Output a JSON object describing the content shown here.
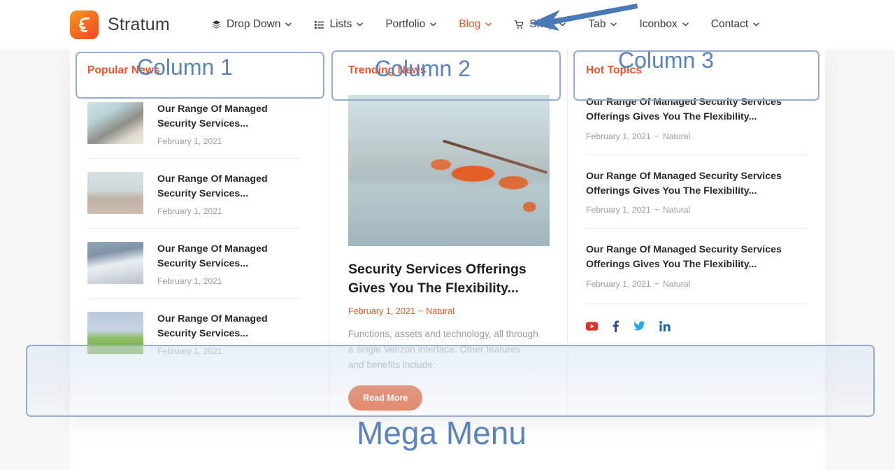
{
  "header": {
    "brand": {
      "name": "Stratum",
      "logo_icon": "stratum-logo-icon"
    },
    "nav": [
      {
        "label": "Drop Down",
        "icon": "layers-icon",
        "caret": "⌄",
        "active": false
      },
      {
        "label": "Lists",
        "icon": "list-icon",
        "caret": "⌄",
        "active": false
      },
      {
        "label": "Portfolio",
        "icon": null,
        "caret": "⌄",
        "active": false
      },
      {
        "label": "Blog",
        "icon": null,
        "caret": "⌄",
        "active": true
      },
      {
        "label": "Shop",
        "icon": "cart-icon",
        "caret": "⌄",
        "active": false
      },
      {
        "label": "Tab",
        "icon": null,
        "caret": "⌄",
        "active": false
      },
      {
        "label": "Iconbox",
        "icon": null,
        "caret": "⌄",
        "active": false
      },
      {
        "label": "Contact",
        "icon": null,
        "caret": "⌄",
        "active": false
      }
    ]
  },
  "mega_menu": {
    "column1": {
      "title": "Popular News",
      "posts": [
        {
          "title": "Our Range Of Managed Security Services...",
          "date": "February 1, 2021",
          "thumb": "rocks-beach-thumb"
        },
        {
          "title": "Our Range Of Managed Security Services...",
          "date": "February 1, 2021",
          "thumb": "lifeguard-tower-thumb"
        },
        {
          "title": "Our Range Of Managed Security Services...",
          "date": "February 1, 2021",
          "thumb": "mountain-clouds-thumb"
        },
        {
          "title": "Our Range Of Managed Security Services...",
          "date": "February 1, 2021",
          "thumb": "palm-leaf-thumb"
        }
      ]
    },
    "column2": {
      "title": "Trending News",
      "feature": {
        "image": "autumn-branch-lake-image",
        "title": "Security Services Offerings Gives You The Flexibility...",
        "date": "February 1, 2021",
        "separator": "~",
        "category": "Natural",
        "excerpt": "Functions, assets and technology, all through a single Verizon interface. Other features and benefits include:",
        "read_more_label": "Read More"
      }
    },
    "column3": {
      "title": "Hot Topics",
      "posts": [
        {
          "title": "Our Range Of Managed Security Services Offerings Gives You The Flexibility...",
          "date": "February 1, 2021",
          "separator": "~",
          "category": "Natural"
        },
        {
          "title": "Our Range Of Managed Security Services Offerings Gives You The Flexibility...",
          "date": "February 1, 2021",
          "separator": "~",
          "category": "Natural"
        },
        {
          "title": "Our Range Of Managed Security Services Offerings Gives You The Flexibility...",
          "date": "February 1, 2021",
          "separator": "~",
          "category": "Natural"
        }
      ],
      "socials": [
        {
          "name": "youtube-icon",
          "color": "#e0302a"
        },
        {
          "name": "facebook-icon",
          "color": "#2b4a91"
        },
        {
          "name": "twitter-icon",
          "color": "#2aa9e0"
        },
        {
          "name": "linkedin-icon",
          "color": "#1b6ca8"
        }
      ]
    }
  },
  "annotations": {
    "column1_label": "Column 1",
    "column2_label": "Column 2",
    "column3_label": "Column 3",
    "mega_menu_label": "Mega Menu",
    "arrow": "arrow-pointing-to-blog",
    "color": "#5b84bd"
  }
}
